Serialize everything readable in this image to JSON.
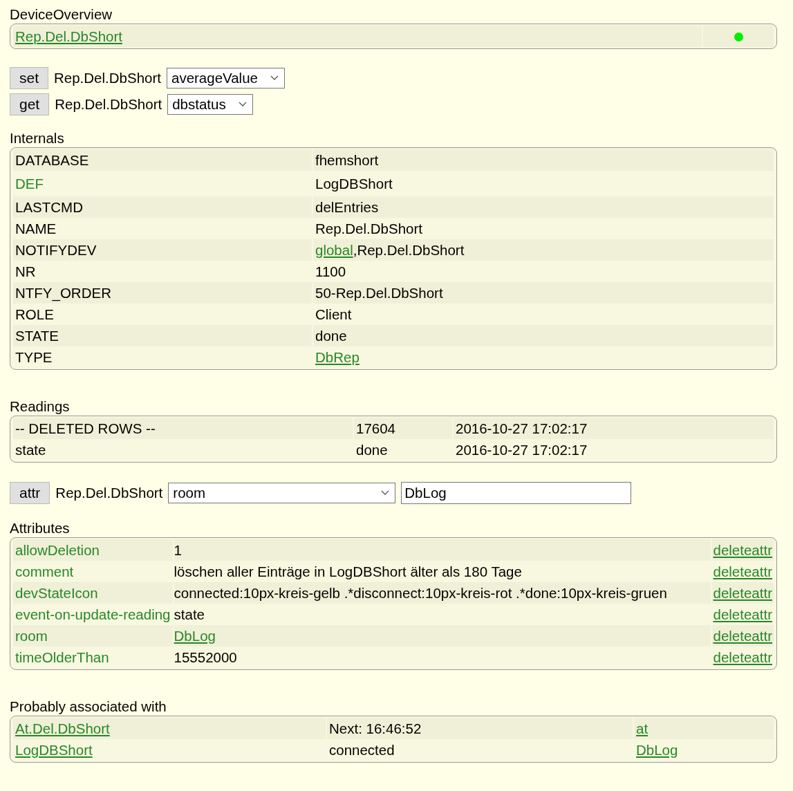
{
  "device_overview": {
    "title": "DeviceOverview",
    "device": "Rep.Del.DbShort",
    "color": "#00ee00"
  },
  "commands": [
    {
      "button": "set",
      "device": "Rep.Del.DbShort",
      "option": "averageValue"
    },
    {
      "button": "get",
      "device": "Rep.Del.DbShort",
      "option": "dbstatus"
    }
  ],
  "internals": {
    "title": "Internals",
    "rows": [
      {
        "key": "DATABASE",
        "kind": "plain",
        "value": [
          {
            "text": "fhemshort",
            "kind": "text"
          }
        ]
      },
      {
        "key": "DEF",
        "kind": "green",
        "value": [
          {
            "text": "LogDBShort",
            "kind": "text"
          }
        ]
      },
      {
        "key": "LASTCMD",
        "kind": "plain",
        "value": [
          {
            "text": "delEntries",
            "kind": "text"
          }
        ]
      },
      {
        "key": "NAME",
        "kind": "plain",
        "value": [
          {
            "text": "Rep.Del.DbShort",
            "kind": "text"
          }
        ]
      },
      {
        "key": "NOTIFYDEV",
        "kind": "plain",
        "value": [
          {
            "text": "global",
            "kind": "link"
          },
          {
            "text": ",Rep.Del.DbShort",
            "kind": "text"
          }
        ]
      },
      {
        "key": "NR",
        "kind": "plain",
        "value": [
          {
            "text": "1100",
            "kind": "text"
          }
        ]
      },
      {
        "key": "NTFY_ORDER",
        "kind": "plain",
        "value": [
          {
            "text": "50-Rep.Del.DbShort",
            "kind": "text"
          }
        ]
      },
      {
        "key": "ROLE",
        "kind": "plain",
        "value": [
          {
            "text": "Client",
            "kind": "text"
          }
        ]
      },
      {
        "key": "STATE",
        "kind": "plain",
        "value": [
          {
            "text": "done",
            "kind": "text"
          }
        ]
      },
      {
        "key": "TYPE",
        "kind": "plain",
        "value": [
          {
            "text": "DbRep",
            "kind": "link"
          }
        ]
      }
    ]
  },
  "readings": {
    "title": "Readings",
    "rows": [
      {
        "name": "-- DELETED ROWS --",
        "value": "17604",
        "time": "2016-10-27 17:02:17"
      },
      {
        "name": "state",
        "value": "done",
        "time": "2016-10-27 17:02:17"
      }
    ]
  },
  "attr_command": {
    "button": "attr",
    "device": "Rep.Del.DbShort",
    "option": "room",
    "value": "DbLog"
  },
  "attributes": {
    "title": "Attributes",
    "rows": [
      {
        "name": "allowDeletion",
        "kind": "text",
        "value": "1",
        "action": "deleteattr"
      },
      {
        "name": "comment",
        "kind": "text",
        "value": "löschen aller Einträge in LogDBShort älter als 180 Tage",
        "action": "deleteattr"
      },
      {
        "name": "devStateIcon",
        "kind": "text",
        "value": "connected:10px-kreis-gelb .*disconnect:10px-kreis-rot .*done:10px-kreis-gruen",
        "action": "deleteattr"
      },
      {
        "name": "event-on-update-reading",
        "kind": "text",
        "value": "state",
        "action": "deleteattr"
      },
      {
        "name": "room",
        "kind": "link",
        "value": "DbLog",
        "action": "deleteattr"
      },
      {
        "name": "timeOlderThan",
        "kind": "text",
        "value": "15552000",
        "action": "deleteattr"
      }
    ]
  },
  "associated": {
    "title": "Probably associated with",
    "rows": [
      {
        "device": "At.Del.DbShort",
        "state": "Next: 16:46:52",
        "type": "at"
      },
      {
        "device": "LogDBShort",
        "state": "connected",
        "type": "DbLog"
      }
    ]
  }
}
